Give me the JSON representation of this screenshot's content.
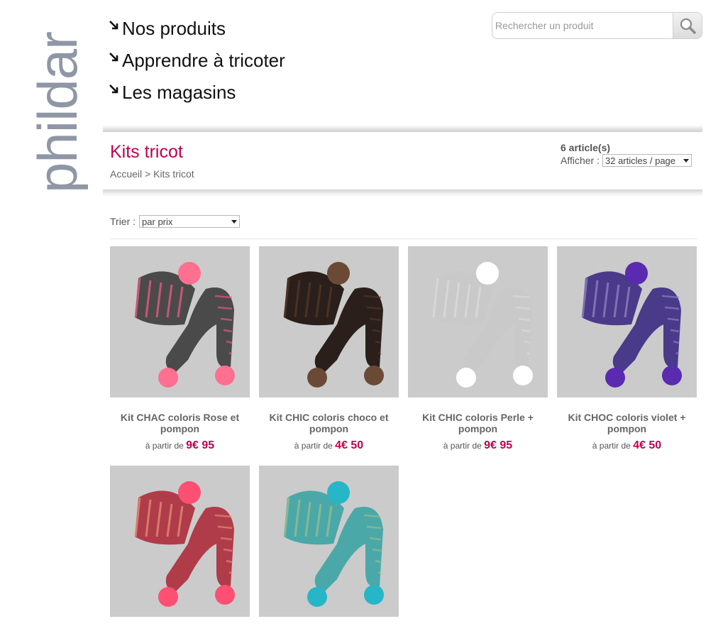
{
  "brand": {
    "logo_text": "phildar"
  },
  "nav": {
    "items": [
      {
        "label": "Nos produits"
      },
      {
        "label": "Apprendre à tricoter"
      },
      {
        "label": "Les magasins"
      }
    ]
  },
  "search": {
    "placeholder": "Rechercher un produit",
    "value": ""
  },
  "category": {
    "title": "Kits tricot",
    "breadcrumb": {
      "home": "Accueil",
      "separator": ">",
      "current": "Kits tricot"
    },
    "count": "6 article(s)",
    "show_label": "Afficher :",
    "per_page": "32 articles / page",
    "sort_label": "Trier :",
    "sort_value": "par prix"
  },
  "products": [
    {
      "name": "Kit CHAC coloris Rose et pompon",
      "price_prefix": "à partir de",
      "price": "9€ 95",
      "colors": {
        "main": "#4a4a4a",
        "accent": "#ff5a8a",
        "pompom": "#ff6f8f"
      }
    },
    {
      "name": "Kit CHIC coloris choco et pompon",
      "price_prefix": "à partir de",
      "price": "4€ 50",
      "colors": {
        "main": "#2a1f1b",
        "accent": "#5a3a2a",
        "pompom": "#6b4a35"
      }
    },
    {
      "name": "Kit CHIC coloris Perle + pompon",
      "price_prefix": "à partir de",
      "price": "9€ 95",
      "colors": {
        "main": "#c9c9c9",
        "accent": "#dddddd",
        "pompom": "#ffffff"
      }
    },
    {
      "name": "Kit CHOC coloris violet + pompon",
      "price_prefix": "à partir de",
      "price": "4€ 50",
      "colors": {
        "main": "#4a3a8a",
        "accent": "#9a86c8",
        "pompom": "#5a2ab0"
      }
    },
    {
      "name": "",
      "price_prefix": "",
      "price": "",
      "colors": {
        "main": "#b03c4a",
        "accent": "#e9967a",
        "pompom": "#ff4f72"
      }
    },
    {
      "name": "",
      "price_prefix": "",
      "price": "",
      "colors": {
        "main": "#4aa8a8",
        "accent": "#a4c08a",
        "pompom": "#26b6c8"
      }
    }
  ],
  "colors": {
    "accent": "#c0004e",
    "text": "#555555"
  }
}
